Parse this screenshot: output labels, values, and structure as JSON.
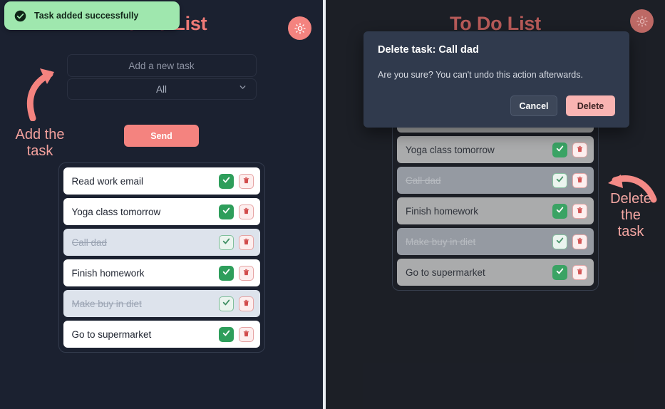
{
  "app": {
    "title": "To Do List",
    "theme_toggle_icon": "sun-icon"
  },
  "toast": {
    "message": "Task added successfully",
    "icon": "check-circle-icon"
  },
  "form": {
    "task_input_placeholder": "Add a new task",
    "task_input_value": "",
    "filter_selected": "All",
    "filter_options": [
      "All"
    ],
    "chevron_icon": "chevron-down-icon",
    "send_label": "Send"
  },
  "tasks": [
    {
      "label": "Read work email",
      "done": false,
      "check_icon": "check-icon",
      "delete_icon": "trash-icon"
    },
    {
      "label": "Yoga class tomorrow",
      "done": false,
      "check_icon": "check-icon",
      "delete_icon": "trash-icon"
    },
    {
      "label": "Call dad",
      "done": true,
      "check_icon": "check-icon",
      "delete_icon": "trash-icon"
    },
    {
      "label": "Finish homework",
      "done": false,
      "check_icon": "check-icon",
      "delete_icon": "trash-icon"
    },
    {
      "label": "Make buy in diet",
      "done": true,
      "check_icon": "check-icon",
      "delete_icon": "trash-icon"
    },
    {
      "label": "Go to supermarket",
      "done": false,
      "check_icon": "check-icon",
      "delete_icon": "trash-icon"
    }
  ],
  "annotations": {
    "add": {
      "text": "Add the\ntask",
      "arrow_icon": "curved-arrow-up-right-icon"
    },
    "delete": {
      "text": "Delete\nthe\ntask",
      "arrow_icon": "curved-arrow-left-icon"
    }
  },
  "modal": {
    "title": "Delete task: Call dad",
    "body": "Are you sure? You can't undo this action afterwards.",
    "cancel_label": "Cancel",
    "delete_label": "Delete"
  },
  "colors": {
    "accent": "#f4837f",
    "title": "#ef7a77",
    "toast_bg": "#9fe7ae",
    "check_green": "#2e9e5b",
    "trash_red": "#d14b4b",
    "panel_left_bg": "#1b2130",
    "panel_right_bg": "#0e1119",
    "modal_bg": "#303a4d",
    "delete_btn_bg": "#f9b4b2"
  }
}
